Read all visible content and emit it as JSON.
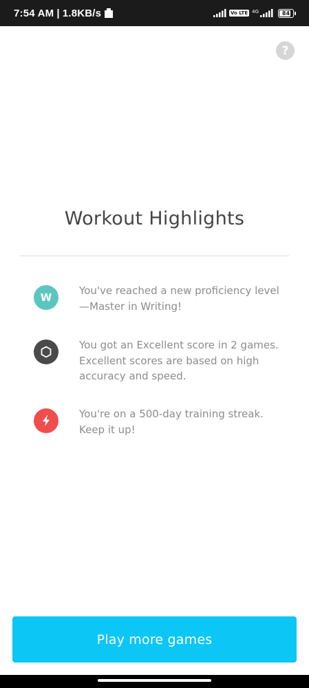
{
  "status_bar": {
    "time": "7:54 AM",
    "separator": "|",
    "data_rate": "1.8KB/s",
    "network_label": "4G",
    "volte_label": "Vo LTE",
    "battery_level": "84",
    "icons": [
      "notification-icon",
      "signal-icon",
      "volte-icon",
      "signal-4g-icon",
      "battery-icon"
    ]
  },
  "help": {
    "label": "?"
  },
  "title": "Workout Highlights",
  "highlights": [
    {
      "icon": "writing-level-icon",
      "badge_letter": "W",
      "badge_color": "#5cc6be",
      "text": "You've reached a new proficiency level —Master in Writing!"
    },
    {
      "icon": "hexagon-score-icon",
      "badge_letter": "",
      "badge_color": "#4a4a4a",
      "text": "You got an Excellent score in 2 games. Excellent scores are based on high accuracy and speed."
    },
    {
      "icon": "lightning-streak-icon",
      "badge_letter": "",
      "badge_color": "#f04e4e",
      "text": "You're on a 500-day training streak. Keep it up!"
    }
  ],
  "cta": {
    "label": "Play more games",
    "color": "#0cc6f5"
  },
  "colors": {
    "status_bar": "#1b1b1b",
    "title": "#454545",
    "body_text": "#8c8c8c",
    "divider": "#dedede",
    "help_button": "#d6d6d6"
  }
}
